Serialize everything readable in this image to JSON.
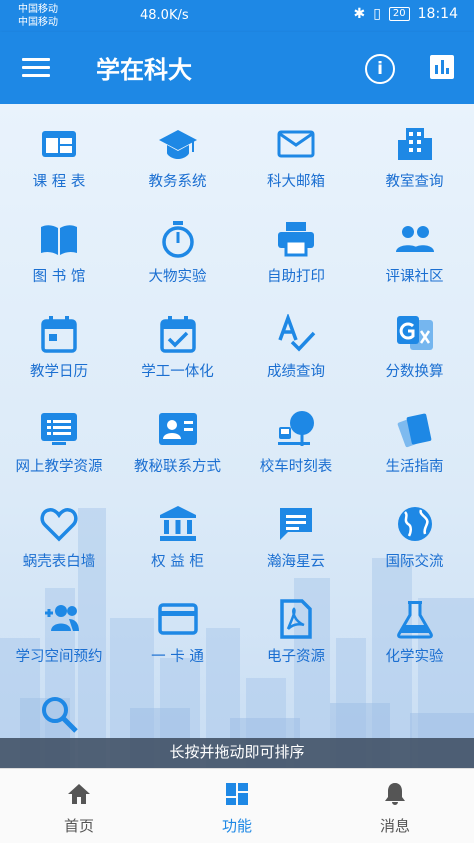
{
  "status": {
    "carrier1": "中国移动",
    "carrier2": "中国移动",
    "speed": "48.0K/s",
    "battery": "20",
    "time": "18:14"
  },
  "appbar": {
    "title": "学在科大",
    "info_label": "i"
  },
  "colors": {
    "primary": "#1e88e5",
    "icon": "#1e88e5",
    "label": "#1b6fd1"
  },
  "grid": [
    {
      "label": "课 程 表",
      "icon": "timetable-icon"
    },
    {
      "label": "教务系统",
      "icon": "graduation-cap-icon"
    },
    {
      "label": "科大邮箱",
      "icon": "mail-icon"
    },
    {
      "label": "教室查询",
      "icon": "building-icon"
    },
    {
      "label": "图 书 馆",
      "icon": "book-icon"
    },
    {
      "label": "大物实验",
      "icon": "stopwatch-icon"
    },
    {
      "label": "自助打印",
      "icon": "printer-icon"
    },
    {
      "label": "评课社区",
      "icon": "people-icon"
    },
    {
      "label": "教学日历",
      "icon": "calendar-icon"
    },
    {
      "label": "学工一体化",
      "icon": "event-check-icon"
    },
    {
      "label": "成绩查询",
      "icon": "spellcheck-icon"
    },
    {
      "label": "分数换算",
      "icon": "translate-icon"
    },
    {
      "label": "网上教学资源",
      "icon": "document-list-icon"
    },
    {
      "label": "教秘联系方式",
      "icon": "contact-card-icon"
    },
    {
      "label": "校车时刻表",
      "icon": "bus-stop-icon"
    },
    {
      "label": "生活指南",
      "icon": "cards-icon"
    },
    {
      "label": "蜗壳表白墙",
      "icon": "heart-icon"
    },
    {
      "label": "权 益 柜",
      "icon": "bank-icon"
    },
    {
      "label": "瀚海星云",
      "icon": "chat-icon"
    },
    {
      "label": "国际交流",
      "icon": "globe-icon"
    },
    {
      "label": "学习空间预约",
      "icon": "group-add-icon"
    },
    {
      "label": "一 卡 通",
      "icon": "card-icon"
    },
    {
      "label": "电子资源",
      "icon": "pdf-icon"
    },
    {
      "label": "化学实验",
      "icon": "flask-icon"
    },
    {
      "label": "",
      "icon": "search-icon"
    }
  ],
  "hint": "长按并拖动即可排序",
  "nav": [
    {
      "label": "首页",
      "icon": "home-icon",
      "active": false
    },
    {
      "label": "功能",
      "icon": "dashboard-icon",
      "active": true
    },
    {
      "label": "消息",
      "icon": "bell-icon",
      "active": false
    }
  ]
}
